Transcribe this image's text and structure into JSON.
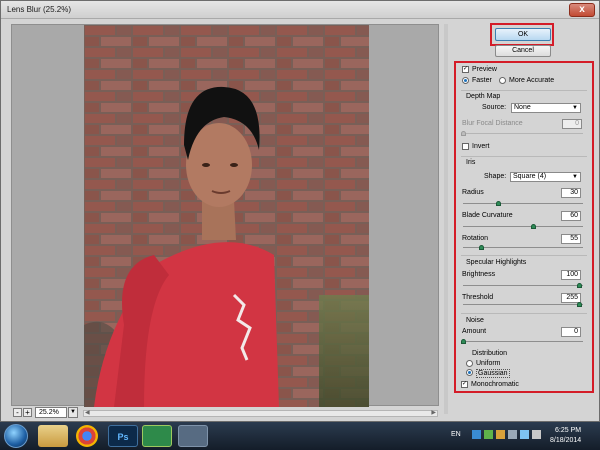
{
  "window": {
    "title": "Lens Blur (25.2%)",
    "close_label": "x"
  },
  "buttons": {
    "ok": "OK",
    "cancel": "Cancel"
  },
  "preview": {
    "label": "Preview",
    "checked": true
  },
  "quality": {
    "faster": "Faster",
    "more_accurate": "More Accurate",
    "selected": "faster"
  },
  "depth_map": {
    "group_label": "Depth Map",
    "source_label": "Source:",
    "source_value": "None",
    "blur_focal_label": "Blur Focal Distance",
    "blur_focal_value": "0",
    "invert_label": "Invert"
  },
  "iris": {
    "group_label": "Iris",
    "shape_label": "Shape:",
    "shape_value": "Square (4)",
    "radius_label": "Radius",
    "radius_value": "30",
    "radius_max": 100,
    "curvature_label": "Blade Curvature",
    "curvature_value": "60",
    "curvature_max": 100,
    "rotation_label": "Rotation",
    "rotation_value": "55",
    "rotation_max": 360
  },
  "specular": {
    "group_label": "Specular Highlights",
    "brightness_label": "Brightness",
    "brightness_value": "100",
    "brightness_max": 100,
    "threshold_label": "Threshold",
    "threshold_value": "255",
    "threshold_max": 255
  },
  "noise": {
    "group_label": "Noise",
    "amount_label": "Amount",
    "amount_value": "0",
    "amount_max": 100,
    "distribution_label": "Distribution",
    "uniform": "Uniform",
    "gaussian": "Gaussian",
    "distribution_selected": "gaussian",
    "monochromatic_label": "Monochromatic",
    "monochromatic_checked": true
  },
  "zoom": {
    "value": "25.2%",
    "minus": "-",
    "plus": "+"
  },
  "taskbar": {
    "language": "EN",
    "time": "6:25 PM",
    "date": "8/18/2014",
    "ps_label": "Ps",
    "icons": [
      "windows-start-icon",
      "folder-icon",
      "chrome-icon",
      "photoshop-icon",
      "app-icon",
      "tools-icon"
    ]
  },
  "colors": {
    "highlight": "#d41c28",
    "slider": "#2e8b57",
    "ok_border": "#3c7fb1"
  }
}
